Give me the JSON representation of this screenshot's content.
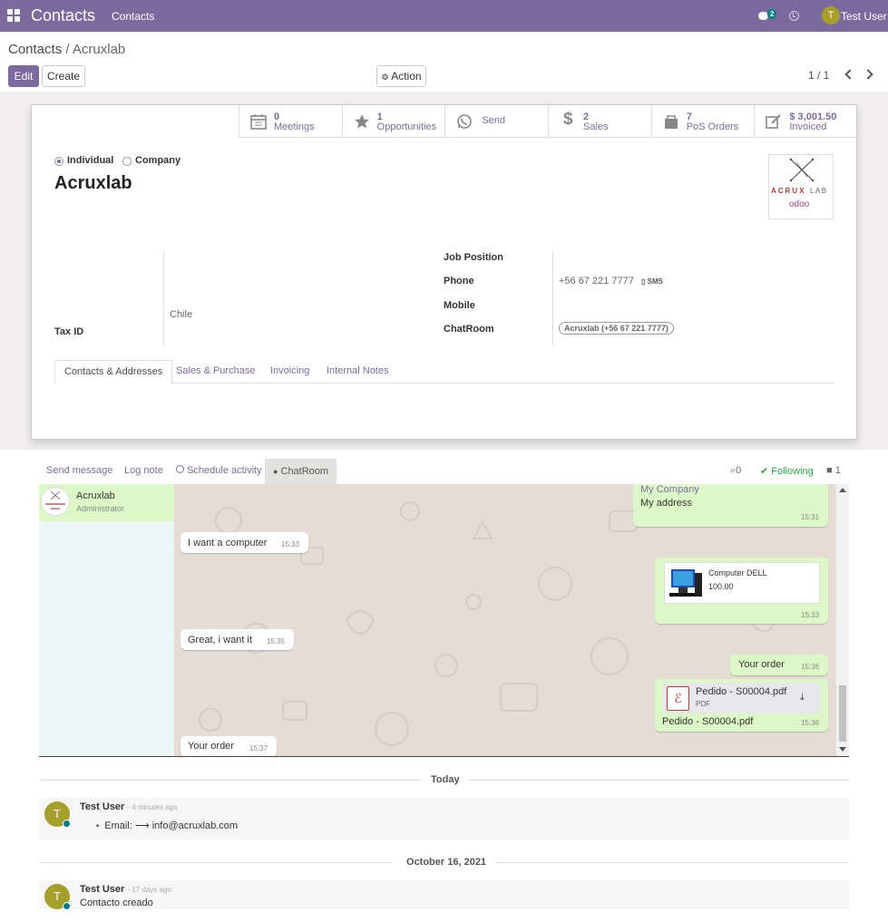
{
  "topbar": {
    "app_title": "Contacts",
    "menu_contacts": "Contacts",
    "chat_count": "2",
    "user_initial": "T",
    "user_name": "Test User"
  },
  "control_panel": {
    "breadcrumb_parent": "Contacts",
    "breadcrumb_sep": "/",
    "breadcrumb_current": "Acruxlab",
    "edit_label": "Edit",
    "create_label": "Create",
    "action_label": "Action",
    "pager": "1 / 1"
  },
  "smart_buttons": [
    {
      "icon": "calendar-icon",
      "value": "0",
      "label": "Meetings"
    },
    {
      "icon": "star-icon",
      "value": "1",
      "label": "Opportunities"
    },
    {
      "icon": "whatsapp-icon",
      "value": "",
      "label": "Send"
    },
    {
      "icon": "dollar-icon",
      "value": "2",
      "label": "Sales"
    },
    {
      "icon": "shopping-bag-icon",
      "value": "7",
      "label": "PoS Orders"
    },
    {
      "icon": "pencil-square-icon",
      "value": "$ 3,001.50",
      "label": "Invoiced"
    }
  ],
  "form": {
    "type_individual": "Individual",
    "type_company": "Company",
    "name": "Acruxlab",
    "logo_text_1": "ACRUX",
    "logo_text_2": "LAB",
    "logo_text_3": "odoo",
    "country": "Chile",
    "tax_id_label": "Tax ID",
    "job_position_label": "Job Position",
    "phone_label": "Phone",
    "phone_value": "+56 67 221 7777",
    "sms_label": "SMS",
    "mobile_label": "Mobile",
    "chatroom_label": "ChatRoom",
    "chatroom_value": "Acruxlab (+56 67 221 7777)"
  },
  "tabs": [
    "Contacts & Addresses",
    "Sales & Purchase",
    "Invoicing",
    "Internal Notes"
  ],
  "chatter_tabs": {
    "send_message": "Send message",
    "log_note": "Log note",
    "schedule_activity": "Schedule activity",
    "chatroom": "ChatRoom",
    "attachments": "0",
    "following": "Following",
    "followers": "1"
  },
  "chatroom": {
    "contact_name": "Acruxlab",
    "contact_role": "Administrator",
    "messages": [
      {
        "dir": "out",
        "line1": "My Company",
        "line2": "My address",
        "time": "15:31"
      },
      {
        "dir": "in",
        "text": "I want a computer",
        "time": "15:33"
      },
      {
        "dir": "out",
        "product": "Computer DELL",
        "price": "100.00",
        "time": "15:33"
      },
      {
        "dir": "in",
        "text": "Great, i want it",
        "time": "15:35"
      },
      {
        "dir": "out",
        "text": "Your order",
        "time": "15:36"
      },
      {
        "dir": "out",
        "file": "Pedido - S00004.pdf",
        "filetype": "PDF",
        "caption": "Pedido - S00004.pdf",
        "time": "15:36"
      },
      {
        "dir": "in",
        "text": "Your order",
        "time": "15:37"
      }
    ]
  },
  "chatter": {
    "today_label": "Today",
    "msg1_author": "Test User",
    "msg1_date": "- 4 minutes ago",
    "msg1_body": "Email: ⟶ info@acruxlab.com",
    "date2_label": "October 16, 2021",
    "msg2_author": "Test User",
    "msg2_date": "- 17 days ago",
    "msg2_body": "Contacto creado",
    "avatar_initial": "T"
  },
  "colors": {
    "brand": "#7c6a9e",
    "chat_green": "#dcf8c6",
    "teal": "#017e84"
  }
}
